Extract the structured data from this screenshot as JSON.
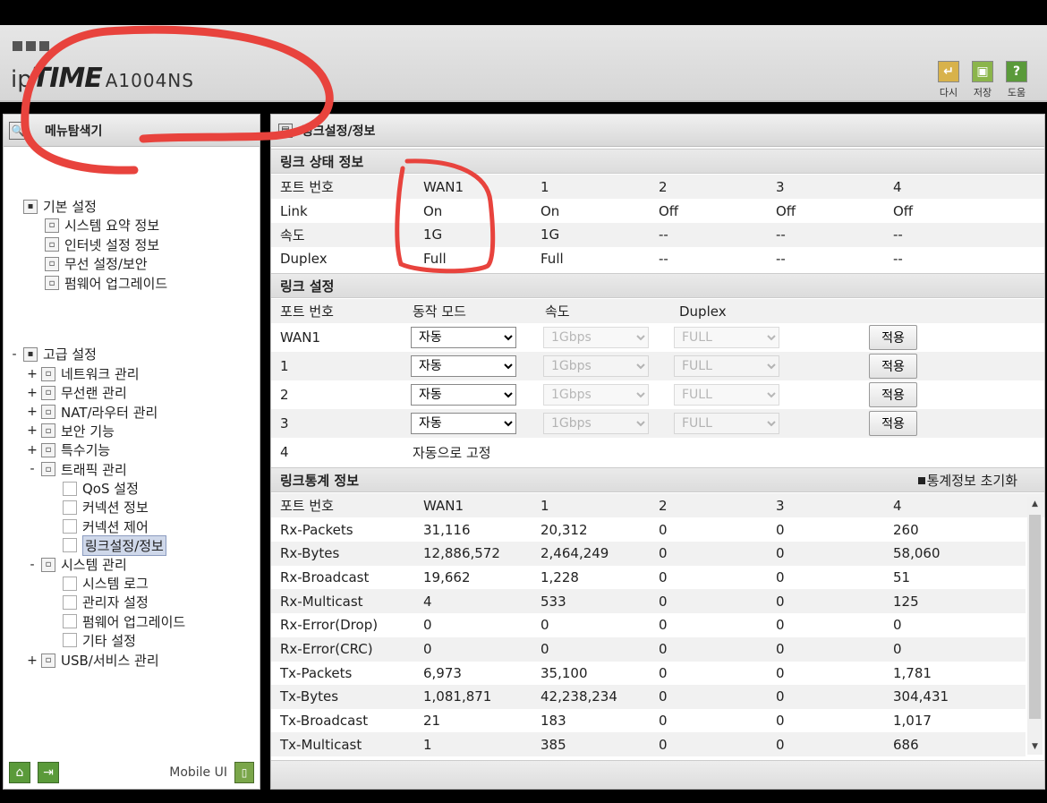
{
  "header": {
    "logo_prefix": "ip",
    "logo_brand": "TIME",
    "logo_model": "A1004NS",
    "tools": [
      {
        "label": "다시",
        "icon": "undo-icon"
      },
      {
        "label": "저장",
        "icon": "save-icon"
      },
      {
        "label": "도움",
        "icon": "help-icon"
      }
    ]
  },
  "sidebar": {
    "title": "메뉴탐색기",
    "basic_title": "기본 설정",
    "basic_items": [
      "시스템 요약 정보",
      "인터넷 설정 정보",
      "무선 설정/보안",
      "펌웨어 업그레이드"
    ],
    "advanced_title": "고급 설정",
    "advanced_items": [
      "네트워크 관리",
      "무선랜 관리",
      "NAT/라우터 관리",
      "보안 기능",
      "특수기능",
      "트래픽 관리"
    ],
    "traffic_children": [
      "QoS 설정",
      "커넥션 정보",
      "커넥션 제어",
      "링크설정/정보"
    ],
    "system_title": "시스템 관리",
    "system_children": [
      "시스템 로그",
      "관리자 설정",
      "펌웨어 업그레이드",
      "기타 설정"
    ],
    "usb_title": "USB/서비스 관리",
    "mobile_label": "Mobile UI"
  },
  "main": {
    "title": "링크설정/정보",
    "status": {
      "title": "링크 상태 정보",
      "header": [
        "포트 번호",
        "WAN1",
        "1",
        "2",
        "3",
        "4"
      ],
      "rows": [
        [
          "Link",
          "On",
          "On",
          "Off",
          "Off",
          "Off"
        ],
        [
          "속도",
          "1G",
          "1G",
          "--",
          "--",
          "--"
        ],
        [
          "Duplex",
          "Full",
          "Full",
          "--",
          "--",
          "--"
        ]
      ]
    },
    "config": {
      "title": "링크 설정",
      "header": [
        "포트 번호",
        "동작 모드",
        "속도",
        "Duplex"
      ],
      "ports": [
        "WAN1",
        "1",
        "2",
        "3"
      ],
      "mode_value": "자동",
      "speed_value": "1Gbps",
      "duplex_value": "FULL",
      "apply_label": "적용",
      "fixed_port": "4",
      "fixed_text": "자동으로 고정"
    },
    "stats": {
      "title": "링크통계 정보",
      "reset_label": "통계정보 초기화",
      "header": [
        "포트 번호",
        "WAN1",
        "1",
        "2",
        "3",
        "4"
      ],
      "rows": [
        [
          "Rx-Packets",
          "31,116",
          "20,312",
          "0",
          "0",
          "260"
        ],
        [
          "Rx-Bytes",
          "12,886,572",
          "2,464,249",
          "0",
          "0",
          "58,060"
        ],
        [
          "Rx-Broadcast",
          "19,662",
          "1,228",
          "0",
          "0",
          "51"
        ],
        [
          "Rx-Multicast",
          "4",
          "533",
          "0",
          "0",
          "125"
        ],
        [
          "Rx-Error(Drop)",
          "0",
          "0",
          "0",
          "0",
          "0"
        ],
        [
          "Rx-Error(CRC)",
          "0",
          "0",
          "0",
          "0",
          "0"
        ],
        [
          "Tx-Packets",
          "6,973",
          "35,100",
          "0",
          "0",
          "1,781"
        ],
        [
          "Tx-Bytes",
          "1,081,871",
          "42,238,234",
          "0",
          "0",
          "304,431"
        ],
        [
          "Tx-Broadcast",
          "21",
          "183",
          "0",
          "0",
          "1,017"
        ],
        [
          "Tx-Multicast",
          "1",
          "385",
          "0",
          "0",
          "686"
        ]
      ]
    }
  }
}
